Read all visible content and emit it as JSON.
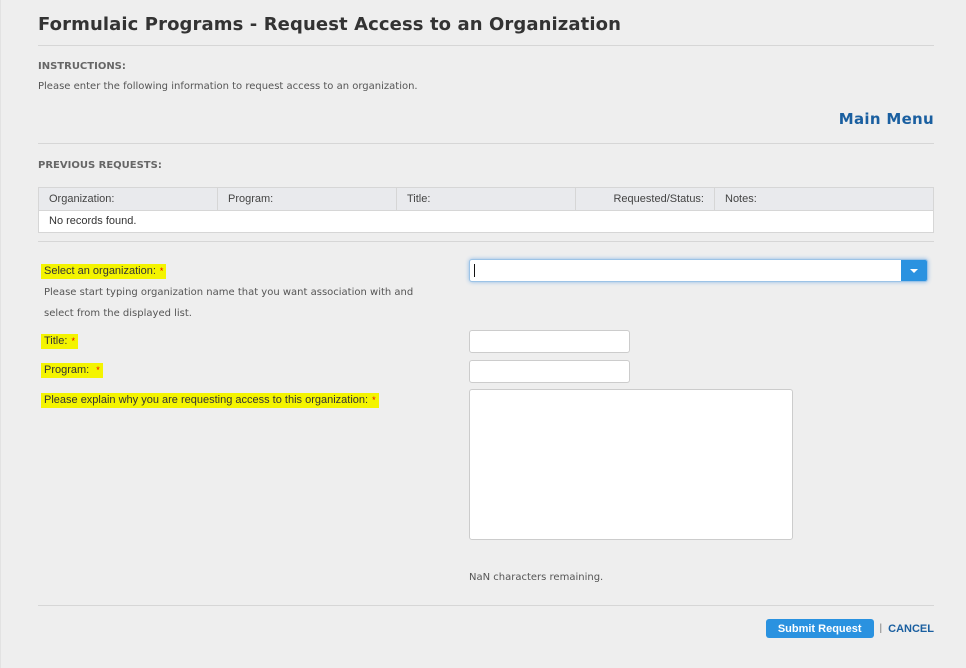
{
  "header": {
    "title": "Formulaic Programs - Request Access to an Organization"
  },
  "instructions": {
    "heading": "INSTRUCTIONS:",
    "text": "Please enter the following information to request access to an organization."
  },
  "nav": {
    "main_menu_label": "Main Menu"
  },
  "previous_requests": {
    "heading": "PREVIOUS REQUESTS:",
    "columns": [
      "Organization:",
      "Program:",
      "Title:",
      "Requested/Status:",
      "Notes:"
    ],
    "empty_message": "No records found."
  },
  "form": {
    "organization": {
      "label": "Select an organization:",
      "required_marker": "*",
      "value": "",
      "help": "Please start typing organization name that you want association with and select from the displayed list."
    },
    "title": {
      "label": "Title:",
      "required_marker": "*",
      "value": ""
    },
    "program": {
      "label": "Program: ",
      "required_marker": "*",
      "value": ""
    },
    "reason": {
      "label": "Please explain why you are requesting access to this organization:",
      "required_marker": "*",
      "value": ""
    },
    "chars_remaining": "NaN characters remaining."
  },
  "actions": {
    "submit_label": "Submit Request",
    "separator": "|",
    "cancel_label": "CANCEL"
  },
  "colors": {
    "accent": "#2a92e0",
    "link": "#1a5fa0",
    "highlight": "#f4f400",
    "required": "#ee0000"
  }
}
